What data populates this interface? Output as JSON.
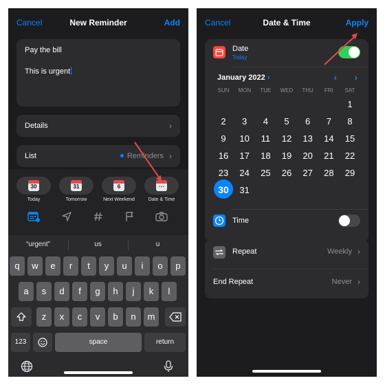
{
  "left_screen": {
    "nav": {
      "cancel": "Cancel",
      "title": "New Reminder",
      "add": "Add"
    },
    "title_value": "Pay the bill",
    "notes_value": "This is urgent",
    "details_label": "Details",
    "list_label": "List",
    "list_value": "Reminders",
    "quick_chips": [
      {
        "number": "30",
        "label": "Today"
      },
      {
        "number": "31",
        "label": "Tomorrow"
      },
      {
        "number": "6",
        "label": "Next Weekend"
      },
      {
        "number": "···",
        "label": "Date & Time"
      }
    ],
    "toolbar_icons": [
      "calendar-icon",
      "location-icon",
      "tag-icon",
      "flag-icon",
      "camera-icon"
    ],
    "suggestions": [
      "“urgent”",
      "us",
      "u"
    ],
    "keyboard": {
      "row1": [
        "q",
        "w",
        "e",
        "r",
        "t",
        "y",
        "u",
        "i",
        "o",
        "p"
      ],
      "row2": [
        "a",
        "s",
        "d",
        "f",
        "g",
        "h",
        "j",
        "k",
        "l"
      ],
      "row3": [
        "z",
        "x",
        "c",
        "v",
        "b",
        "n",
        "m"
      ],
      "numbers": "123",
      "space": "space",
      "return": "return"
    }
  },
  "right_screen": {
    "nav": {
      "cancel": "Cancel",
      "title": "Date & Time",
      "apply": "Apply"
    },
    "date_label": "Date",
    "date_sub": "Today",
    "date_toggle_on": true,
    "month_label": "January 2022",
    "weekdays": [
      "SUN",
      "MON",
      "TUE",
      "WED",
      "THU",
      "FRI",
      "SAT"
    ],
    "first_weekday_index": 6,
    "days_in_month": 31,
    "selected_day": 30,
    "time_label": "Time",
    "time_toggle_on": false,
    "repeat_label": "Repeat",
    "repeat_value": "Weekly",
    "end_repeat_label": "End Repeat",
    "end_repeat_value": "Never"
  },
  "colors": {
    "accent": "#0a84ff",
    "toggle_on": "#30d158",
    "toggle_off": "#48484a",
    "annotation_arrow": "#e5484d"
  }
}
